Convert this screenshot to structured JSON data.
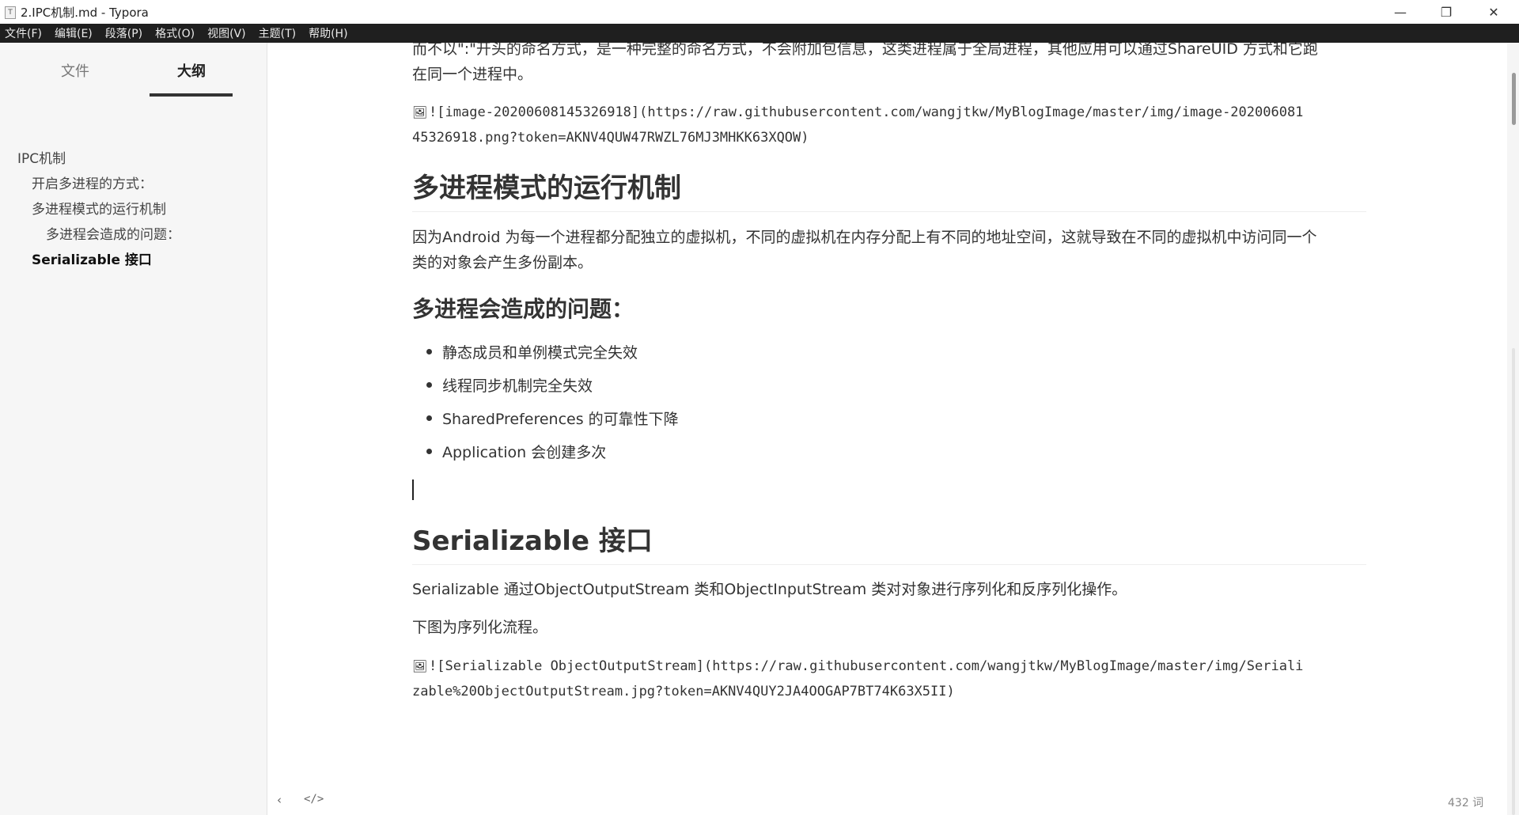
{
  "window": {
    "icon_text": "T",
    "title": "2.IPC机制.md - Typora",
    "minimize": "—",
    "maximize": "❐",
    "close": "✕"
  },
  "menu": [
    "文件(F)",
    "编辑(E)",
    "段落(P)",
    "格式(O)",
    "视图(V)",
    "主题(T)",
    "帮助(H)"
  ],
  "sidebar": {
    "tabs": {
      "files": "文件",
      "outline": "大纲"
    },
    "outline": [
      {
        "label": "IPC机制",
        "level": 1
      },
      {
        "label": "开启多进程的方式：",
        "level": 2
      },
      {
        "label": "多进程模式的运行机制",
        "level": 2
      },
      {
        "label": "多进程会造成的问题：",
        "level": 3
      },
      {
        "label": "Serializable 接口",
        "level": 2,
        "active": true
      }
    ]
  },
  "editor": {
    "para_top_1": "而不以\":\"开头的命名方式，是一种完整的命名方式，不会附加包信息，这类进程属于全局进程，其他应用可以通过ShareUID 方式和它跑",
    "para_top_2": "在同一个进程中。",
    "img1_icon": "🖼",
    "img1_line1": "![image-20200608145326918](https://raw.githubusercontent.com/wangjtkw/MyBlogImage/master/img/image-202006081",
    "img1_line2": "45326918.png?token=AKNV4QUW47RWZL76MJ3MHKK63XQOW)",
    "h2_multiprocess": "多进程模式的运行机制",
    "para_android_1": "因为Android 为每一个进程都分配独立的虚拟机，不同的虚拟机在内存分配上有不同的地址空间，这就导致在不同的虚拟机中访问同一个",
    "para_android_2": "类的对象会产生多份副本。",
    "h3_problems": "多进程会造成的问题：",
    "problems": [
      "静态成员和单例模式完全失效",
      "线程同步机制完全失效",
      "SharedPreferences 的可靠性下降",
      "Application 会创建多次"
    ],
    "h2_serializable": "Serializable 接口",
    "para_serializable": "Serializable  通过ObjectOutputStream 类和ObjectInputStream 类对对象进行序列化和反序列化操作。",
    "para_flow": "下图为序列化流程。",
    "img2_icon": "🖼",
    "img2_line1": "![Serializable ObjectOutputStream](https://raw.githubusercontent.com/wangjtkw/MyBlogImage/master/img/Seriali",
    "img2_line2": "zable%20ObjectOutputStream.jpg?token=AKNV4QUY2JA4OOGAP7BT74K63X5II)"
  },
  "status": {
    "back": "‹",
    "source_mode": "</>",
    "word_count": "432 词"
  }
}
